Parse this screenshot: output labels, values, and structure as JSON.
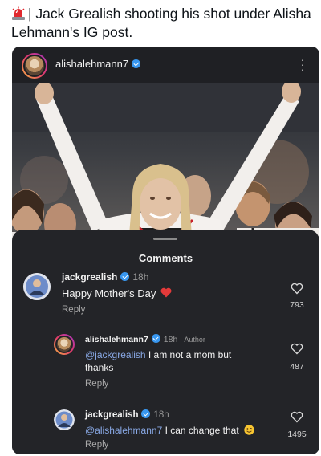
{
  "tweet": {
    "emoji_icon": "police-siren-icon",
    "text": "| Jack Grealish shooting his shot under Alisha Lehmann's IG post."
  },
  "post": {
    "username": "alishalehmann7",
    "verified": true,
    "more_icon": "more-vertical-icon"
  },
  "comments_sheet": {
    "title": "Comments",
    "reply_label": "Reply",
    "comments": [
      {
        "username": "jackgrealish",
        "time": "18h",
        "author_tag": "",
        "mention": "",
        "text": "Happy Mother's Day",
        "emoji": "red-heart-icon",
        "likes": "793"
      },
      {
        "username": "alishalehmann7",
        "time": "18h",
        "author_tag": "· Author",
        "mention": "@jackgrealish",
        "text": " I am not a mom but thanks",
        "emoji": "",
        "likes": "487"
      },
      {
        "username": "jackgrealish",
        "time": "18h",
        "author_tag": "",
        "mention": "@alishalehmann7",
        "text": " I can change that",
        "emoji": "grinning-face-icon",
        "likes": "1495"
      }
    ]
  },
  "colors": {
    "card_bg": "#1b1c20",
    "sheet_bg": "#232428",
    "mention": "#89a9e6",
    "verified": "#3897f0",
    "heart": "#e33a3a"
  }
}
